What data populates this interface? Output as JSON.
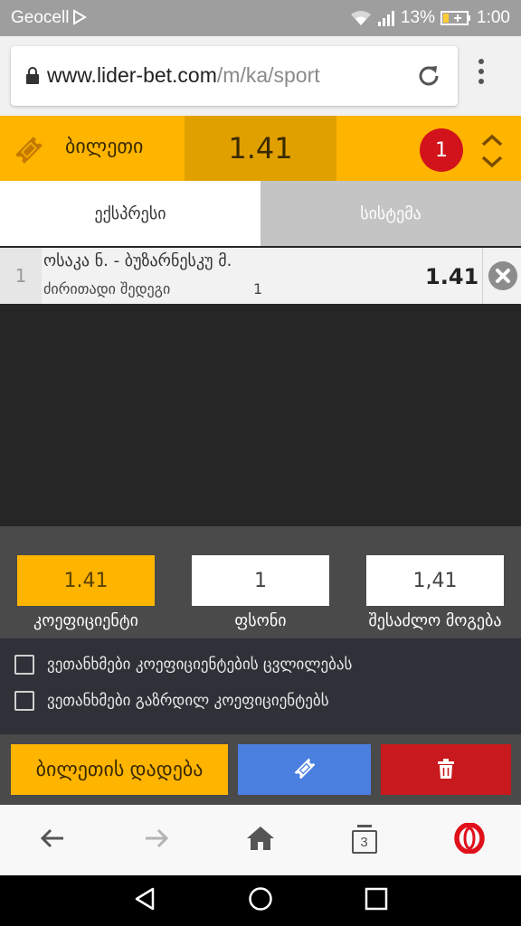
{
  "status_bar": {
    "carrier": "Geocell",
    "battery": "13%",
    "time": "1:00"
  },
  "browser": {
    "url_host": "www.lider-bet.com",
    "url_path": "/m/ka/sport",
    "tab_count": "3"
  },
  "ticket": {
    "title": "ბილეთი",
    "total_odds": "1.41",
    "selection_count": "1"
  },
  "tabs": [
    {
      "label": "ექსპრესი",
      "active": true
    },
    {
      "label": "სისტემა",
      "active": false
    }
  ],
  "bets": [
    {
      "index": "1",
      "match": "ოსაკა ნ. - ბუზარნესკუ მ.",
      "market": "ძირითადი შედეგი",
      "outcome": "1",
      "odds": "1.41"
    }
  ],
  "stake_panel": {
    "coefficient_value": "1.41",
    "coefficient_label": "კოეფიციენტი",
    "stake_value": "1",
    "stake_label": "ფსონი",
    "possible_win_value": "1,41",
    "possible_win_label": "შესაძლო მოგება"
  },
  "agreements": [
    {
      "label": "ვეთანხმები კოეფიციენტების ცვლილებას",
      "checked": false
    },
    {
      "label": "ვეთანხმები გაზრდილ კოეფიციენტებს",
      "checked": false
    }
  ],
  "actions": {
    "place_bet_label": "ბილეთის დადება"
  },
  "colors": {
    "brand_yellow": "#ffb400",
    "brand_yellow_dark": "#e0a000",
    "save_blue": "#4a7fe0",
    "clear_red": "#c8191e",
    "badge_red": "#d3131b",
    "opera_red": "#e0101a"
  }
}
